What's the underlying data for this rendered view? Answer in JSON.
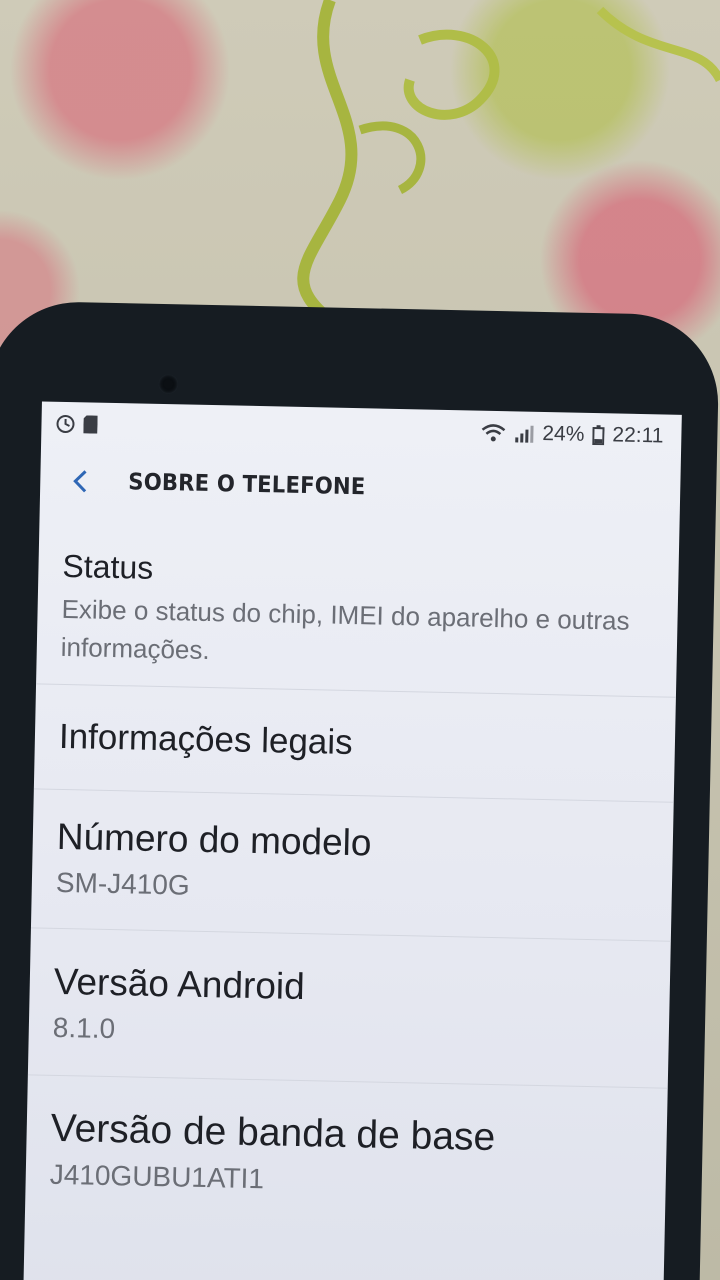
{
  "status_bar": {
    "left_icons": [
      "circle-status-icon",
      "sd-card-icon"
    ],
    "right_icons": [
      "wifi-icon",
      "signal-icon",
      "battery-icon"
    ],
    "battery": "24%",
    "time": "22:11"
  },
  "app_bar": {
    "back_icon": "chevron-left-icon",
    "title": "SOBRE O TELEFONE"
  },
  "items": [
    {
      "title": "Status",
      "subtitle": "Exibe o status do chip, IMEI do aparelho e outras informações."
    },
    {
      "title": "Informações legais",
      "subtitle": ""
    },
    {
      "title": "Número do modelo",
      "subtitle": "SM-J410G"
    },
    {
      "title": "Versão Android",
      "subtitle": "8.1.0"
    },
    {
      "title": "Versão de banda de base",
      "subtitle": "J410GUBU1ATI1"
    }
  ],
  "colors": {
    "accent": "#2f67b5",
    "screen_bg": "#eef0f6",
    "phone_frame": "#161c22"
  }
}
